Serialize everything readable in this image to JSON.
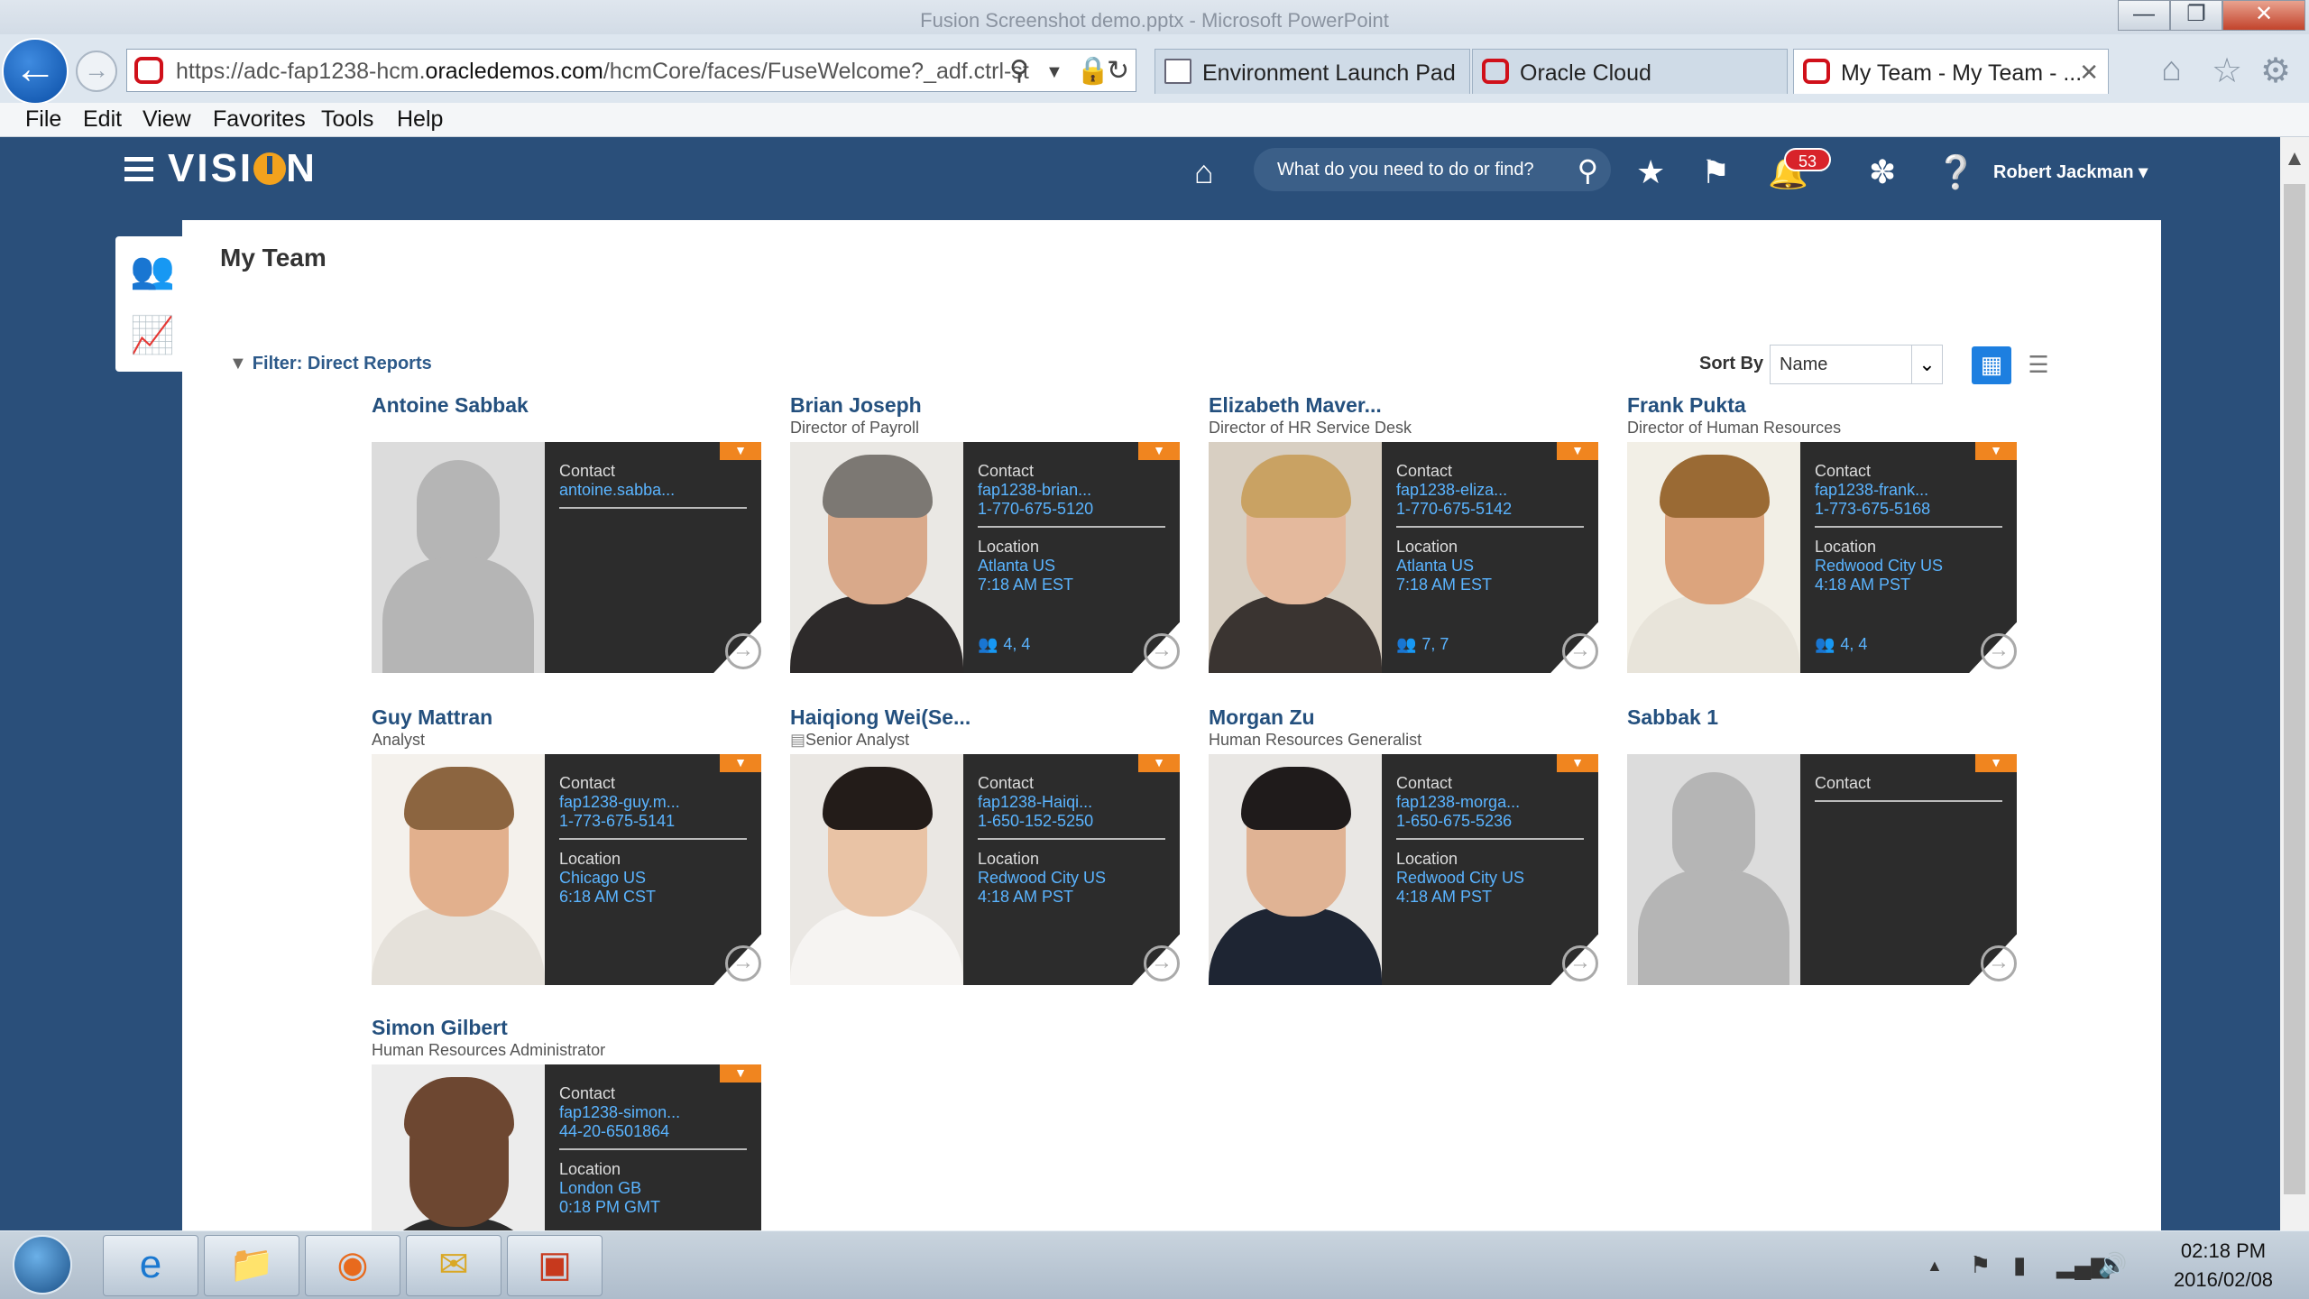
{
  "window": {
    "title": "Fusion Screenshot demo.pptx - Microsoft PowerPoint"
  },
  "browser": {
    "url": "https://adc-fap1238-hcm.oraclsdemos.com/hcmCore/faces/FuseWelcome?_adf.ctrl-st",
    "url_prefix": "https://adc-fap1238-hcm.",
    "url_domain": "oracledemos.com",
    "url_path": "/hcmCore/faces/FuseWelcome?_adf.ctrl-st",
    "tabs": [
      {
        "label": "Environment Launch Pad"
      },
      {
        "label": "Oracle Cloud"
      },
      {
        "label": "My Team - My Team - ..."
      }
    ],
    "menu": [
      "File",
      "Edit",
      "View",
      "Favorites",
      "Tools",
      "Help"
    ]
  },
  "app": {
    "logo": "VISI N",
    "search_placeholder": "What do you need to do or find?",
    "notifications_count": "53",
    "user_name": "Robert Jackman",
    "accent": "#2a4f7a",
    "orange": "#f0851f"
  },
  "page": {
    "title": "My Team",
    "filter_label": "Filter: Direct Reports",
    "sort_label": "Sort By",
    "sort_value": "Name"
  },
  "people": [
    {
      "name": "Antoine Sabbak",
      "job": "",
      "contact_label": "Contact",
      "email": "antoine.sabba...",
      "phone": "",
      "location_label": "",
      "location": "",
      "time": "",
      "reports": "",
      "photo": "silhouette"
    },
    {
      "name": "Brian Joseph",
      "job": "Director of Payroll",
      "contact_label": "Contact",
      "email": "fap1238-brian...",
      "phone": "1-770-675-5120",
      "location_label": "Location",
      "location": "Atlanta US",
      "time": "7:18 AM EST",
      "reports": "4, 4",
      "photo": "man-gray-hair"
    },
    {
      "name": "Elizabeth Maver...",
      "job": "Director of HR Service Desk",
      "contact_label": "Contact",
      "email": "fap1238-eliza...",
      "phone": "1-770-675-5142",
      "location_label": "Location",
      "location": "Atlanta US",
      "time": "7:18 AM EST",
      "reports": "7, 7",
      "photo": "woman-blonde"
    },
    {
      "name": "Frank Pukta",
      "job": "Director of Human Resources",
      "contact_label": "Contact",
      "email": "fap1238-frank...",
      "phone": "1-773-675-5168",
      "location_label": "Location",
      "location": "Redwood City US",
      "time": "4:18 AM PST",
      "reports": "4, 4",
      "photo": "man-long-hair"
    },
    {
      "name": "Guy Mattran",
      "job": "Analyst",
      "contact_label": "Contact",
      "email": "fap1238-guy.m...",
      "phone": "1-773-675-5141",
      "location_label": "Location",
      "location": "Chicago US",
      "time": "6:18 AM CST",
      "reports": "",
      "photo": "man-smiling"
    },
    {
      "name": "Haiqiong Wei(Se...",
      "job": "Senior Analyst",
      "contact_label": "Contact",
      "email": "fap1238-Haiqi...",
      "phone": "1-650-152-5250",
      "location_label": "Location",
      "location": "Redwood City US",
      "time": "4:18 AM PST",
      "reports": "",
      "photo": "woman-glasses"
    },
    {
      "name": "Morgan Zu",
      "job": "Human Resources Generalist",
      "contact_label": "Contact",
      "email": "fap1238-morga...",
      "phone": "1-650-675-5236",
      "location_label": "Location",
      "location": "Redwood City US",
      "time": "4:18 AM PST",
      "reports": "",
      "photo": "man-dark-hair"
    },
    {
      "name": "Sabbak 1",
      "job": "",
      "contact_label": "Contact",
      "email": "",
      "phone": "",
      "location_label": "",
      "location": "",
      "time": "",
      "reports": "",
      "photo": "silhouette"
    },
    {
      "name": "Simon Gilbert",
      "job": "Human Resources Administrator",
      "contact_label": "Contact",
      "email": "fap1238-simon...",
      "phone": "44-20-6501864",
      "location_label": "Location",
      "location": "London GB",
      "time": "0:18 PM GMT",
      "reports": "",
      "photo": "man-bald"
    }
  ],
  "taskbar": {
    "time": "02:18 PM",
    "date": "2016/02/08"
  }
}
